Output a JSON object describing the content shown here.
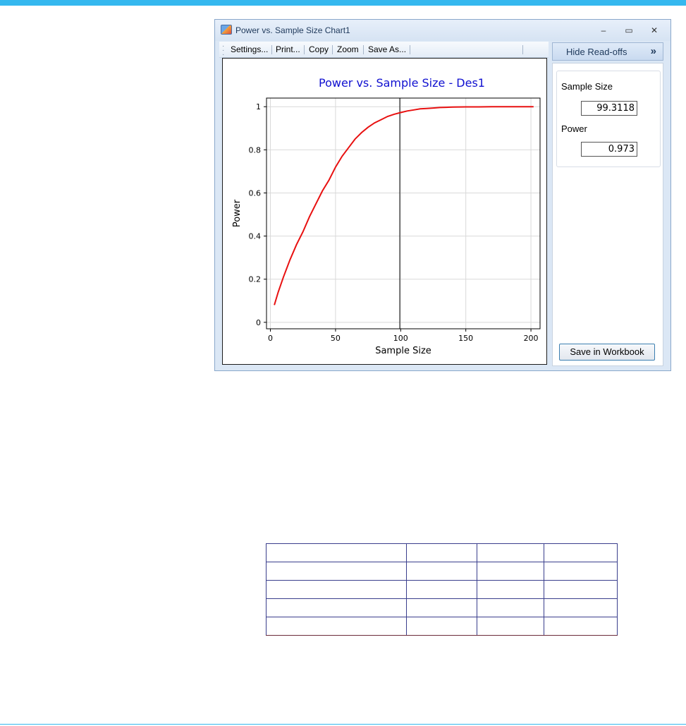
{
  "window": {
    "title": "Power vs. Sample Size Chart1",
    "controls": {
      "minimize": "‒",
      "maximize": "▭",
      "close": "✕"
    }
  },
  "toolbar": {
    "settings": "Settings...",
    "print": "Print...",
    "copy": "Copy",
    "zoom": "Zoom",
    "save_as": "Save As..."
  },
  "readoffs": {
    "toggle_label": "Hide Read-offs",
    "toggle_chevron": "»",
    "sample_size_label": "Sample Size",
    "sample_size_value": "99.3118",
    "power_label": "Power",
    "power_value": "0.973",
    "save_button": "Save in Workbook"
  },
  "colors": {
    "title": "#1010d0",
    "curve": "#e81010",
    "accent_bar": "#35b8ef"
  },
  "chart_data": {
    "type": "line",
    "title": "Power vs. Sample Size - Des1",
    "xlabel": "Sample Size",
    "ylabel": "Power",
    "xlim": [
      -3,
      207
    ],
    "ylim": [
      -0.03,
      1.04
    ],
    "x_ticks": [
      0,
      50,
      100,
      150,
      200
    ],
    "y_ticks": [
      0,
      0.2,
      0.4,
      0.6,
      0.8,
      1
    ],
    "y_tick_labels": [
      "0",
      "0.2",
      "0.4",
      "0.6",
      "0.8",
      "1"
    ],
    "grid": true,
    "readoff_x": 99.3118,
    "series": [
      {
        "x": [
          3,
          6,
          10,
          15,
          20,
          25,
          30,
          35,
          40,
          45,
          50,
          55,
          60,
          65,
          70,
          75,
          80,
          85,
          90,
          95,
          100,
          105,
          110,
          115,
          120,
          125,
          130,
          135,
          140,
          150,
          160,
          170,
          180,
          190,
          202
        ],
        "y": [
          0.08,
          0.14,
          0.21,
          0.29,
          0.36,
          0.42,
          0.49,
          0.55,
          0.61,
          0.66,
          0.72,
          0.77,
          0.81,
          0.85,
          0.88,
          0.905,
          0.925,
          0.94,
          0.955,
          0.965,
          0.973,
          0.98,
          0.985,
          0.99,
          0.992,
          0.994,
          0.996,
          0.997,
          0.998,
          0.999,
          0.999,
          1,
          1,
          1,
          1
        ]
      }
    ]
  }
}
